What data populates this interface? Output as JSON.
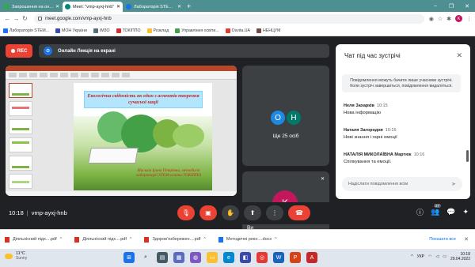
{
  "browser": {
    "tabs": [
      {
        "label": "Запрошення на онлайн-трене...",
        "color": "#34a853",
        "active": false
      },
      {
        "label": "Meet: \"vmp-ayxj-hnb\"",
        "color": "#00897b",
        "active": true
      },
      {
        "label": "Лабораторія STEM-освіти ТОКІП...",
        "color": "#1a73e8",
        "active": false
      }
    ],
    "new_tab": "+",
    "window_controls": [
      "–",
      "❐",
      "✕"
    ],
    "url": "meet.google.com/vmp-ayxj-hnb",
    "profile_initial": "K"
  },
  "bookmarks": [
    {
      "label": "Лабораторія STEM...",
      "color": "#1a73e8"
    },
    {
      "label": "МОН України",
      "color": "#3949ab"
    },
    {
      "label": "IM3O",
      "color": "#546e7a"
    },
    {
      "label": "ТОКІППО",
      "color": "#d32f2f"
    },
    {
      "label": "Розклад",
      "color": "#fbc02d"
    },
    {
      "label": "Управління освіти...",
      "color": "#43a047"
    },
    {
      "label": "Osvita.UA",
      "color": "#e53935"
    },
    {
      "label": "НЕНЦУМ",
      "color": "#6d4c41"
    }
  ],
  "meet": {
    "rec_label": "REC",
    "presenter_badge": "O",
    "presenting_label": "Онлайн Лекція на екрані",
    "slide": {
      "title": "Екологічна свідомість як один з аспектів творення сучасної нації",
      "author": "Миськів Ірина Петрівна, методист лабораторії STEM-освіти ТОКІППО"
    },
    "participants_tile": {
      "initials": [
        "O",
        "H"
      ],
      "count_label": "Ще 25 осіб"
    },
    "self_tile": {
      "initial": "K",
      "name": "Ви"
    },
    "meeting_time": "10:18",
    "meeting_code": "vmp-ayxj-hnb",
    "people_count": "27"
  },
  "chat": {
    "title": "Чат під час зустрічі",
    "notice": "Повідомлення можуть бачити лише учасники зустрічі. Коли зустріч завершиться, повідомлення видаляться.",
    "messages": [
      {
        "sender": "Неля Захарків",
        "time": "10:15",
        "text": "Нова інформацію"
      },
      {
        "sender": "Наталя Загородня",
        "time": "10:16",
        "text": "Нові знання і гарні емоції"
      },
      {
        "sender": "НАТАЛІЯ МИКОЛАЇВНА Мартюк",
        "time": "10:16",
        "text": "Спілкування та емоції."
      }
    ],
    "input_placeholder": "Надіслати повідомлення всім"
  },
  "downloads": {
    "items": [
      "Діяльнісний підх....pdf",
      "Діяльнісний підх....pdf",
      "Здоров'язбережен....pdf",
      "Методичні реко....docx"
    ],
    "show_all": "Показати все"
  },
  "taskbar": {
    "temperature": "11°C",
    "weather": "Sunny",
    "language": "УКР",
    "time": "10:18",
    "date": "29.04.2022"
  }
}
